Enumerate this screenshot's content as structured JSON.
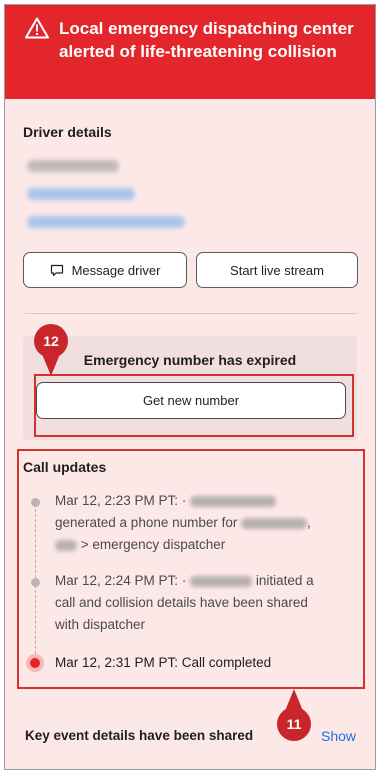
{
  "alert": {
    "title": "Local emergency dispatching center alerted of life-threatening collision",
    "icon": "warning-triangle-icon",
    "color": "#e3262b"
  },
  "driver": {
    "section_title": "Driver details",
    "message_button": "Message driver",
    "livestream_button": "Start live stream"
  },
  "emergency": {
    "title": "Emergency number has expired",
    "get_number_button": "Get new number"
  },
  "call_updates": {
    "title": "Call updates",
    "items": [
      {
        "time": "Mar 12, 2:23 PM PT:",
        "line1_rest": "",
        "line2": "generated a phone number for",
        "line3": "> emergency dispatcher"
      },
      {
        "time": "Mar 12, 2:24 PM PT:",
        "rest": "initiated a",
        "line2": "call and collision details have been shared",
        "line3": "with dispatcher"
      },
      {
        "text": "Mar 12, 2:31 PM PT: Call completed"
      }
    ]
  },
  "key_event": {
    "text": "Key event details have been shared",
    "show_link": "Show"
  },
  "annotations": {
    "marker_a": "12",
    "marker_b": "11",
    "color": "#d5312f"
  }
}
